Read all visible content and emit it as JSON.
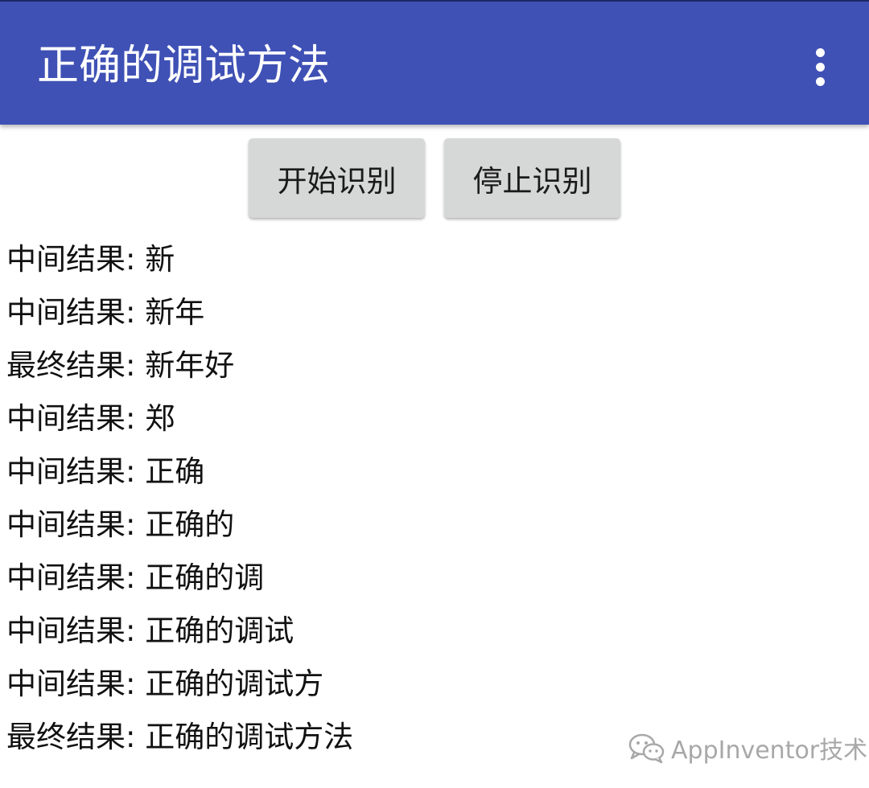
{
  "app_bar": {
    "title": "正确的调试方法",
    "background": "#3f51b5",
    "overflow_icon": "more-vertical-icon"
  },
  "buttons": {
    "start_label": "开始识别",
    "stop_label": "停止识别"
  },
  "results": [
    {
      "label": "中间结果:",
      "text": "新"
    },
    {
      "label": "中间结果:",
      "text": "新年"
    },
    {
      "label": "最终结果:",
      "text": "新年好"
    },
    {
      "label": "中间结果:",
      "text": "郑"
    },
    {
      "label": "中间结果:",
      "text": "正确"
    },
    {
      "label": "中间结果:",
      "text": "正确的"
    },
    {
      "label": "中间结果:",
      "text": "正确的调"
    },
    {
      "label": "中间结果:",
      "text": "正确的调试"
    },
    {
      "label": "中间结果:",
      "text": "正确的调试方"
    },
    {
      "label": "最终结果:",
      "text": "正确的调试方法"
    }
  ],
  "watermark": {
    "icon": "wechat-icon",
    "text": "AppInventor技术"
  }
}
